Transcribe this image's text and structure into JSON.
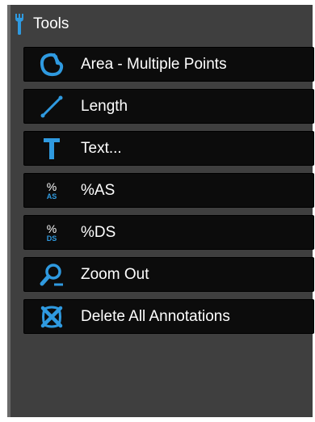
{
  "panel": {
    "title": "Tools",
    "title_icon": "wrench-icon"
  },
  "tools": [
    {
      "label": "Area - Multiple Points",
      "icon": "area-lasso-icon"
    },
    {
      "label": "Length",
      "icon": "length-line-icon"
    },
    {
      "label": "Text...",
      "icon": "text-t-icon"
    },
    {
      "label": "%AS",
      "icon": "percent-as-icon",
      "icon_text_top": "%",
      "icon_text_bottom": "AS"
    },
    {
      "label": "%DS",
      "icon": "percent-ds-icon",
      "icon_text_top": "%",
      "icon_text_bottom": "DS"
    },
    {
      "label": "Zoom Out",
      "icon": "zoom-out-icon"
    },
    {
      "label": "Delete All Annotations",
      "icon": "delete-annotations-icon"
    }
  ],
  "colors": {
    "panel_bg": "#3f3f3f",
    "item_bg": "#0c0c0c",
    "accent": "#2f9ae0",
    "text": "#ffffff"
  }
}
